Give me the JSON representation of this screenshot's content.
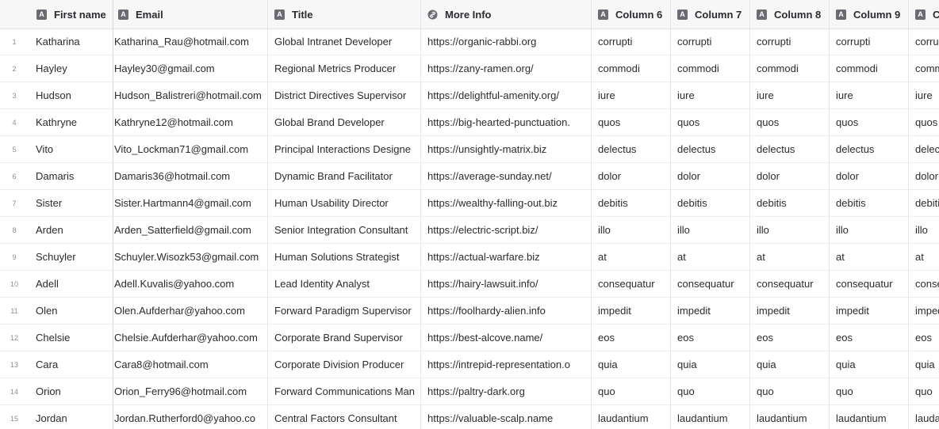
{
  "columns": [
    {
      "label": "First name",
      "icon": "text-type-icon"
    },
    {
      "label": "Email",
      "icon": "text-type-icon"
    },
    {
      "label": "Title",
      "icon": "text-type-icon"
    },
    {
      "label": "More Info",
      "icon": "link-type-icon"
    },
    {
      "label": "Column 6",
      "icon": "text-type-icon"
    },
    {
      "label": "Column 7",
      "icon": "text-type-icon"
    },
    {
      "label": "Column 8",
      "icon": "text-type-icon"
    },
    {
      "label": "Column 9",
      "icon": "text-type-icon"
    },
    {
      "label": "C",
      "icon": "text-type-icon"
    }
  ],
  "rows": [
    {
      "num": "1",
      "first": "Katharina",
      "email": "Katharina_Rau@hotmail.com",
      "title": "Global Intranet Developer",
      "more": "https://organic-rabbi.org",
      "c6": "corrupti",
      "c7": "corrupti",
      "c8": "corrupti",
      "c9": "corrupti",
      "c10": "corrupti"
    },
    {
      "num": "2",
      "first": "Hayley",
      "email": "Hayley30@gmail.com",
      "title": "Regional Metrics Producer",
      "more": "https://zany-ramen.org/",
      "c6": "commodi",
      "c7": "commodi",
      "c8": "commodi",
      "c9": "commodi",
      "c10": "commodi"
    },
    {
      "num": "3",
      "first": "Hudson",
      "email": "Hudson_Balistreri@hotmail.com",
      "title": "District Directives Supervisor",
      "more": "https://delightful-amenity.org/",
      "c6": "iure",
      "c7": "iure",
      "c8": "iure",
      "c9": "iure",
      "c10": "iure"
    },
    {
      "num": "4",
      "first": "Kathryne",
      "email": "Kathryne12@hotmail.com",
      "title": "Global Brand Developer",
      "more": "https://big-hearted-punctuation.",
      "c6": "quos",
      "c7": "quos",
      "c8": "quos",
      "c9": "quos",
      "c10": "quos"
    },
    {
      "num": "5",
      "first": "Vito",
      "email": "Vito_Lockman71@gmail.com",
      "title": "Principal Interactions Designe",
      "more": "https://unsightly-matrix.biz",
      "c6": "delectus",
      "c7": "delectus",
      "c8": "delectus",
      "c9": "delectus",
      "c10": "delectus"
    },
    {
      "num": "6",
      "first": "Damaris",
      "email": "Damaris36@hotmail.com",
      "title": "Dynamic Brand Facilitator",
      "more": "https://average-sunday.net/",
      "c6": "dolor",
      "c7": "dolor",
      "c8": "dolor",
      "c9": "dolor",
      "c10": "dolor"
    },
    {
      "num": "7",
      "first": "Sister",
      "email": "Sister.Hartmann4@gmail.com",
      "title": "Human Usability Director",
      "more": "https://wealthy-falling-out.biz",
      "c6": "debitis",
      "c7": "debitis",
      "c8": "debitis",
      "c9": "debitis",
      "c10": "debitis"
    },
    {
      "num": "8",
      "first": "Arden",
      "email": "Arden_Satterfield@gmail.com",
      "title": "Senior Integration Consultant",
      "more": "https://electric-script.biz/",
      "c6": "illo",
      "c7": "illo",
      "c8": "illo",
      "c9": "illo",
      "c10": "illo"
    },
    {
      "num": "9",
      "first": "Schuyler",
      "email": "Schuyler.Wisozk53@gmail.com",
      "title": "Human Solutions Strategist",
      "more": "https://actual-warfare.biz",
      "c6": "at",
      "c7": "at",
      "c8": "at",
      "c9": "at",
      "c10": "at"
    },
    {
      "num": "10",
      "first": "Adell",
      "email": "Adell.Kuvalis@yahoo.com",
      "title": "Lead Identity Analyst",
      "more": "https://hairy-lawsuit.info/",
      "c6": "consequatur",
      "c7": "consequatur",
      "c8": "consequatur",
      "c9": "consequatur",
      "c10": "consequatur"
    },
    {
      "num": "11",
      "first": "Olen",
      "email": "Olen.Aufderhar@yahoo.com",
      "title": "Forward Paradigm Supervisor",
      "more": "https://foolhardy-alien.info",
      "c6": "impedit",
      "c7": "impedit",
      "c8": "impedit",
      "c9": "impedit",
      "c10": "impedit"
    },
    {
      "num": "12",
      "first": "Chelsie",
      "email": "Chelsie.Aufderhar@yahoo.com",
      "title": "Corporate Brand Supervisor",
      "more": "https://best-alcove.name/",
      "c6": "eos",
      "c7": "eos",
      "c8": "eos",
      "c9": "eos",
      "c10": "eos"
    },
    {
      "num": "13",
      "first": "Cara",
      "email": "Cara8@hotmail.com",
      "title": "Corporate Division Producer",
      "more": "https://intrepid-representation.o",
      "c6": "quia",
      "c7": "quia",
      "c8": "quia",
      "c9": "quia",
      "c10": "quia"
    },
    {
      "num": "14",
      "first": "Orion",
      "email": "Orion_Ferry96@hotmail.com",
      "title": "Forward Communications Man",
      "more": "https://paltry-dark.org",
      "c6": "quo",
      "c7": "quo",
      "c8": "quo",
      "c9": "quo",
      "c10": "quo"
    },
    {
      "num": "15",
      "first": "Jordan",
      "email": "Jordan.Rutherford0@yahoo.co",
      "title": "Central Factors Consultant",
      "more": "https://valuable-scalp.name",
      "c6": "laudantium",
      "c7": "laudantium",
      "c8": "laudantium",
      "c9": "laudantium",
      "c10": "laudantium"
    }
  ]
}
